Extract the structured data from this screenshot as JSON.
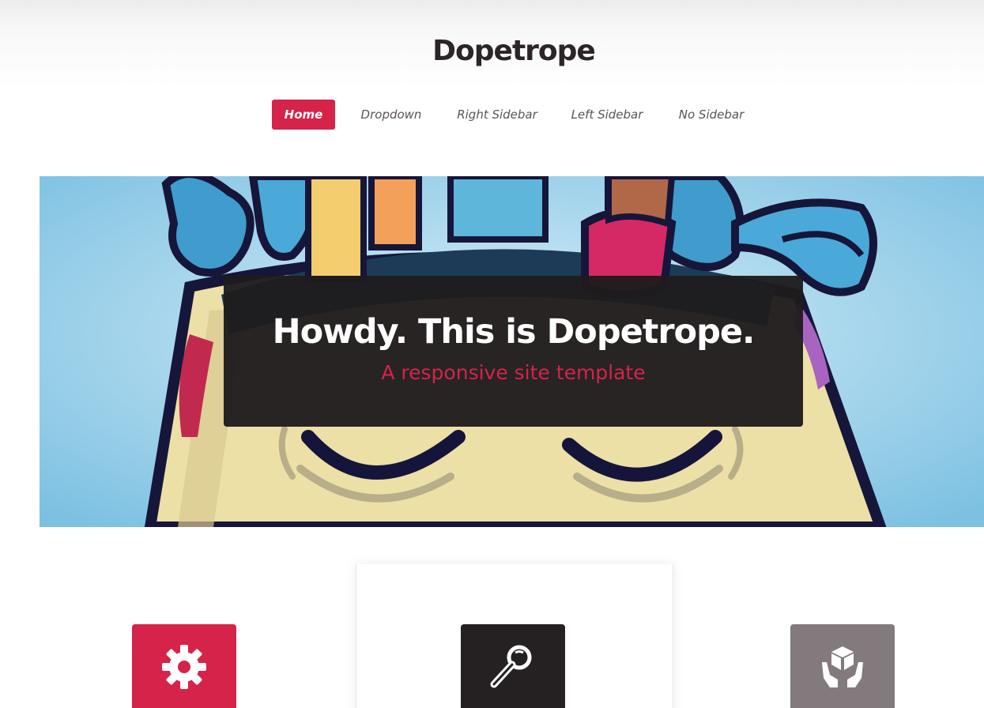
{
  "site": {
    "title": "Dopetrope"
  },
  "nav": {
    "items": [
      {
        "label": "Home",
        "active": true
      },
      {
        "label": "Dropdown",
        "active": false
      },
      {
        "label": "Right Sidebar",
        "active": false
      },
      {
        "label": "Left Sidebar",
        "active": false
      },
      {
        "label": "No Sidebar",
        "active": false
      }
    ]
  },
  "banner": {
    "heading": "Howdy. This is Dopetrope.",
    "subheading": "A responsive site template"
  },
  "features": [
    {
      "icon": "gear-icon",
      "color": "#d52349"
    },
    {
      "icon": "magnifier-icon",
      "color": "#252122"
    },
    {
      "icon": "hands-package-icon",
      "color": "#827a7c"
    }
  ],
  "colors": {
    "accent": "#d52349",
    "dark": "#252122",
    "muted": "#827a7c",
    "sky": "#86c6e4"
  }
}
